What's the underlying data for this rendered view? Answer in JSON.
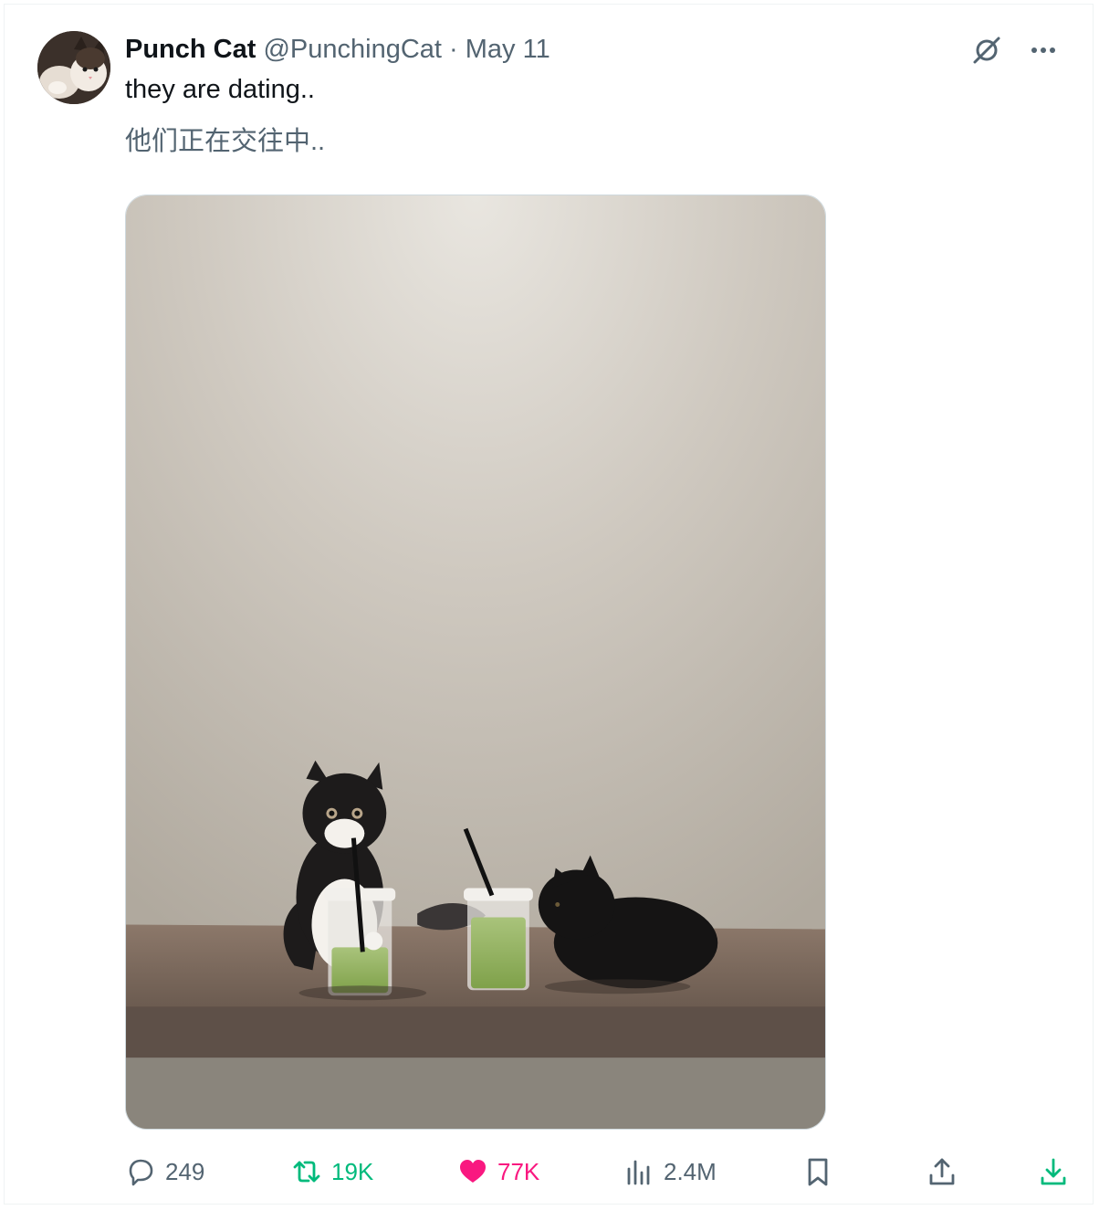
{
  "post": {
    "author_name": "Punch Cat",
    "author_handle": "@PunchingCat",
    "separator": "·",
    "date": "May 11",
    "text": "they are dating..",
    "translation": "他们正在交往中.."
  },
  "actions": {
    "replies": "249",
    "retweets": "19K",
    "likes": "77K",
    "views": "2.4M"
  },
  "colors": {
    "retweet": "#00ba7c",
    "like": "#f91880",
    "secondary_text": "#536471"
  },
  "icons": {
    "top_right": [
      "grok-icon",
      "more-icon"
    ],
    "action_bar": [
      "reply-icon",
      "retweet-icon",
      "like-icon",
      "views-icon",
      "bookmark-icon",
      "share-icon",
      "download-icon"
    ]
  }
}
